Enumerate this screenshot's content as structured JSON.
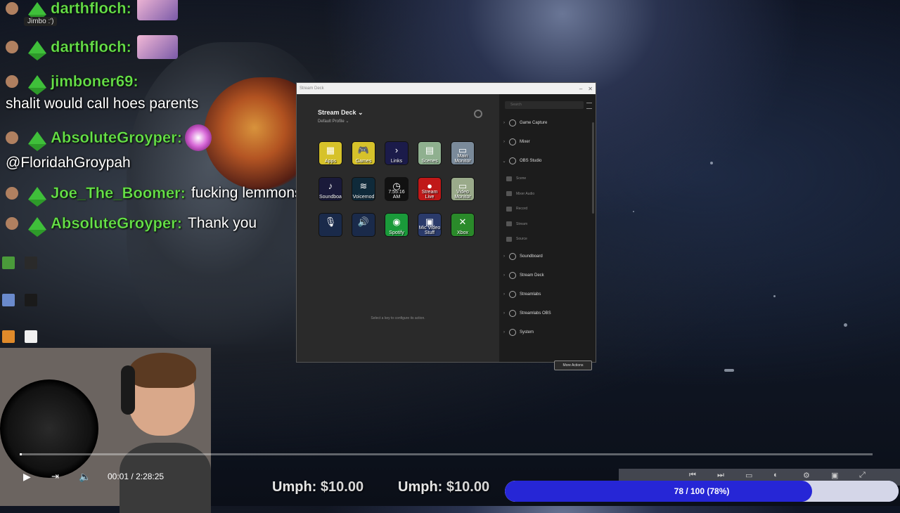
{
  "chat": [
    {
      "user": "darthfloch:",
      "message": "",
      "emote": "anime-emote"
    },
    {
      "user": "",
      "message": "",
      "tag": "Jimbo :')"
    },
    {
      "user": "darthfloch:",
      "message": "",
      "emote": "anime-emote"
    },
    {
      "user": "jimboner69:",
      "message": ""
    },
    {
      "user": "",
      "message": "shalit would call hoes parents"
    },
    {
      "user": "AbsoluteGroyper:",
      "message": "",
      "emote": "heart-emote"
    },
    {
      "user": "",
      "message": "@FloridahGroypah"
    },
    {
      "user": "Joe_The_Boomer:",
      "message": "fucking lemmons"
    },
    {
      "user": "AbsoluteGroyper:",
      "message": "Thank you"
    }
  ],
  "chat_tag": "Jimbo :')",
  "streamdeck": {
    "title": "Stream Deck",
    "profile": "Default Profile",
    "hint": "Select a key to configure its action.",
    "search_placeholder": "Search",
    "keys": [
      {
        "label": "Apps",
        "glyph": "▦",
        "bg": "#d6c22a"
      },
      {
        "label": "Games",
        "glyph": "🎮",
        "bg": "#d6c22a"
      },
      {
        "label": "Links",
        "glyph": "›",
        "bg": "#1b1b4a"
      },
      {
        "label": "Scenes",
        "glyph": "▤",
        "bg": "#8fb08f"
      },
      {
        "label": "Main Monitor",
        "glyph": "▭",
        "bg": "#7a8a9a"
      },
      {
        "label": "Soundboard",
        "glyph": "♪",
        "bg": "#1a1a3a"
      },
      {
        "label": "Voicemod",
        "glyph": "≋",
        "bg": "#0f2a3a"
      },
      {
        "label": "7:55:16 AM",
        "glyph": "◷",
        "bg": "#111111"
      },
      {
        "label": "Stream Live",
        "glyph": "●",
        "bg": "#c01818"
      },
      {
        "label": "Video Monitor",
        "glyph": "▭",
        "bg": "#9aaa8a"
      },
      {
        "label": "",
        "glyph": "🎙",
        "bg": "#1a2a4a"
      },
      {
        "label": "",
        "glyph": "🔊",
        "bg": "#1a2a4a"
      },
      {
        "label": "Spotify",
        "glyph": "◉",
        "bg": "#1a9a3a"
      },
      {
        "label": "Mic Video Stuff",
        "glyph": "▣",
        "bg": "#2a3a6a"
      },
      {
        "label": "Xbox",
        "glyph": "✕",
        "bg": "#2a8a2a"
      }
    ],
    "categories": [
      {
        "label": "Game Capture",
        "chev": "›"
      },
      {
        "label": "Mixer",
        "chev": "›"
      },
      {
        "label": "OBS Studio",
        "chev": "⌄"
      }
    ],
    "obs_items": [
      "Scene",
      "Mixer Audio",
      "Record",
      "Stream",
      "Source"
    ],
    "categories2": [
      {
        "label": "Soundboard",
        "chev": "›"
      },
      {
        "label": "Stream Deck",
        "chev": "›"
      },
      {
        "label": "Streamlabs",
        "chev": "›"
      },
      {
        "label": "Streamlabs OBS",
        "chev": "›"
      },
      {
        "label": "System",
        "chev": "›"
      }
    ],
    "more_actions": "More Actions"
  },
  "player": {
    "current_time": "00:01",
    "separator": "/",
    "duration": "2:28:25",
    "progress_fraction": 0.0001
  },
  "donations": [
    {
      "name": "Umph:",
      "amount": "$10.00"
    },
    {
      "name": "Umph:",
      "amount": "$10.00"
    }
  ],
  "goal": {
    "text": "78 / 100 (78%)",
    "fraction": 0.78,
    "fill_color": "#2626d6",
    "rest_color": "#d4d6e8"
  },
  "colors": {
    "username": "#69e14b"
  }
}
